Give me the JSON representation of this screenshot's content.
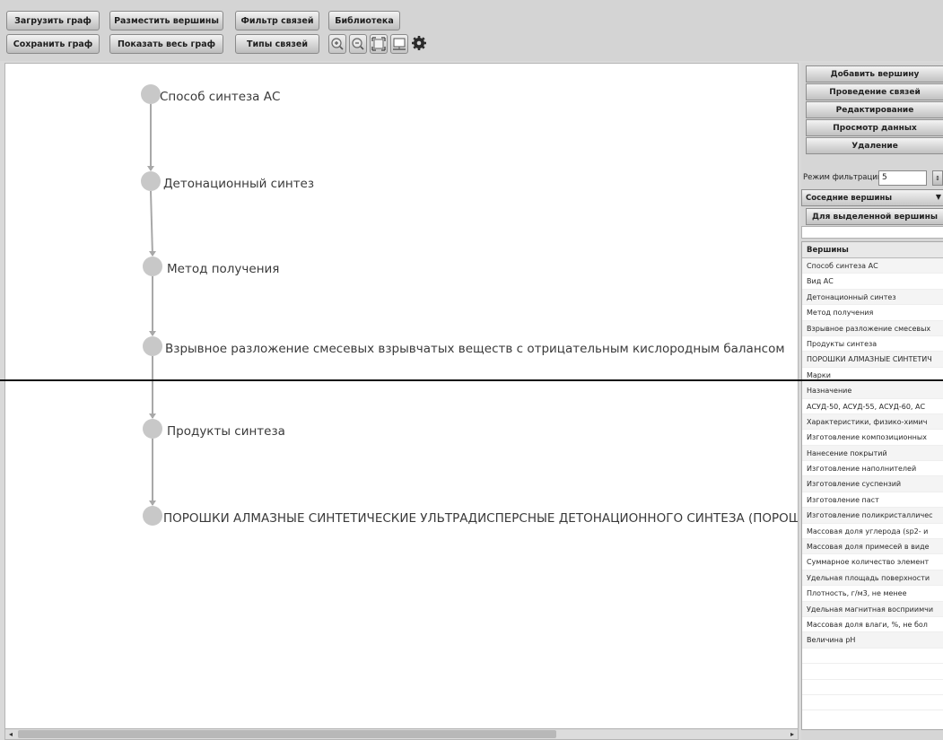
{
  "toolbar": {
    "row1": [
      "Загрузить граф",
      "Разместить вершины",
      "Фильтр связей",
      "Библиотека"
    ],
    "row2": [
      "Сохранить граф",
      "Показать весь граф",
      "Типы связей"
    ],
    "icons": [
      "zoom-in-icon",
      "zoom-out-icon",
      "fit-to-screen-icon",
      "export-image-icon",
      "settings-gear-icon"
    ]
  },
  "graph": {
    "nodes": [
      "Способ синтеза АС",
      "Детонационный синтез",
      "Метод получения",
      "Взрывное разложение смесевых взрывчатых веществ с отрицательным кислородным балансом",
      "Продукты синтеза",
      "ПОРОШКИ АЛМАЗНЫЕ СИНТЕТИЧЕСКИЕ УЛЬТРАДИСПЕРСНЫЕ ДЕТОНАЦИОННОГО СИНТЕЗА (ПОРОШКИ УДА)"
    ],
    "node_color": "#c8c8c8",
    "edge_color": "#a8a8a8"
  },
  "panel": {
    "buttons": [
      "Добавить вершину",
      "Проведение связей",
      "Редактирование",
      "Просмотр данных",
      "Удаление"
    ],
    "filter_label": "Режим фильтрации:",
    "filter_value": "5",
    "neighbors_select": "Соседние вершины",
    "for_selected_button": "Для выделенной вершины",
    "vertices_header": "Вершины",
    "vertices": [
      "Способ синтеза АС",
      "Вид АС",
      "Детонационный синтез",
      "Метод получения",
      "Взрывное разложение смесевых",
      "Продукты синтеза",
      "ПОРОШКИ АЛМАЗНЫЕ СИНТЕТИЧ",
      "Марки",
      "Назначение",
      "АСУД-50, АСУД-55, АСУД-60, АС",
      "Характеристики, физико-химич",
      "Изготовление композиционных",
      "Нанесение покрытий",
      "Изготовление наполнителей",
      "Изготовление суспензий",
      "Изготовление паст",
      "Изготовление поликристалличес",
      "Массовая доля углерода (sp2- и",
      "Массовая доля примесей в виде",
      "Суммарное количество элемент",
      "Удельная площадь поверхности",
      "Плотность, г/м3, не менее",
      "Удельная магнитная восприимчи",
      "Массовая доля влаги, %, не бол",
      "Величина pH"
    ]
  }
}
